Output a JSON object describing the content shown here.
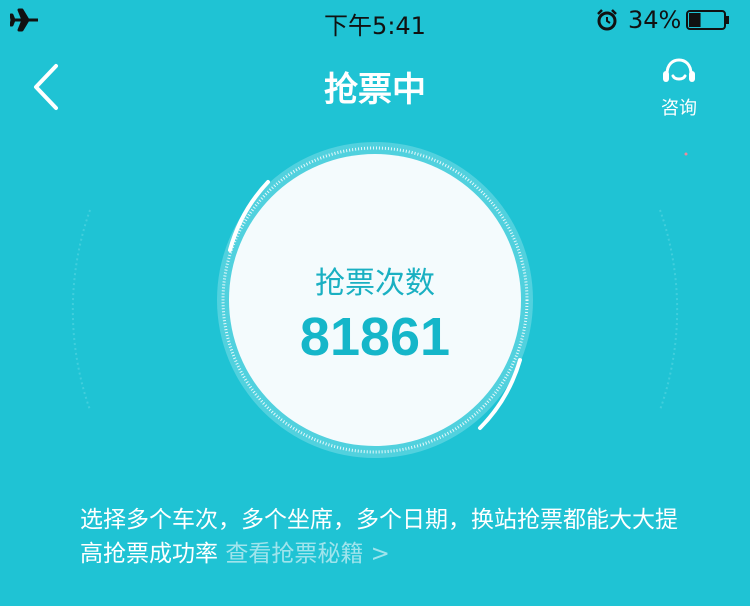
{
  "status_bar": {
    "time": "下午5:41",
    "battery_percent": "34%",
    "battery_level": 0.34
  },
  "nav": {
    "title": "抢票中",
    "consult_label": "咨询"
  },
  "counter": {
    "label": "抢票次数",
    "value": "81861"
  },
  "tip": {
    "text": "选择多个车次，多个坐席，多个日期，换站抢票都能大大提高抢票成功率",
    "link_text": "查看抢票秘籍",
    "link_arrow": ">"
  },
  "colors": {
    "background": "#1fc3d4",
    "accent": "#15b6c9",
    "circle": "#f4fbfd"
  }
}
